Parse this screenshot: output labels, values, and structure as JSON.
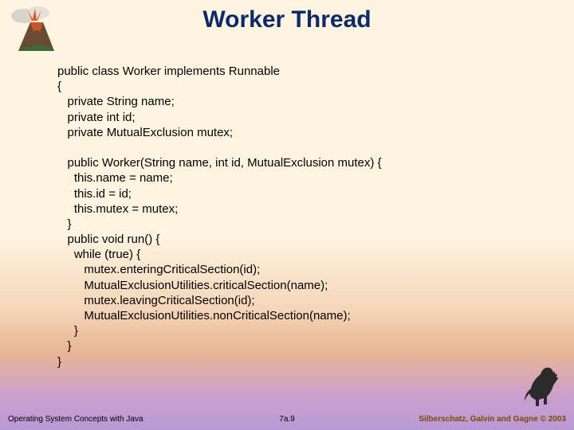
{
  "title": "Worker Thread",
  "code": "public class Worker implements Runnable\n{\n   private String name;\n   private int id;\n   private MutualExclusion mutex;\n\n   public Worker(String name, int id, MutualExclusion mutex) {\n     this.name = name;\n     this.id = id;\n     this.mutex = mutex;\n   }\n   public void run() {\n     while (true) {\n        mutex.enteringCriticalSection(id);\n        MutualExclusionUtilities.criticalSection(name);\n        mutex.leavingCriticalSection(id);\n        MutualExclusionUtilities.nonCriticalSection(name);\n     }\n   }\n}",
  "footer": {
    "left": "Operating System Concepts with Java",
    "center": "7a.9",
    "right": "Silberschatz, Galvin and Gagne © 2003"
  }
}
